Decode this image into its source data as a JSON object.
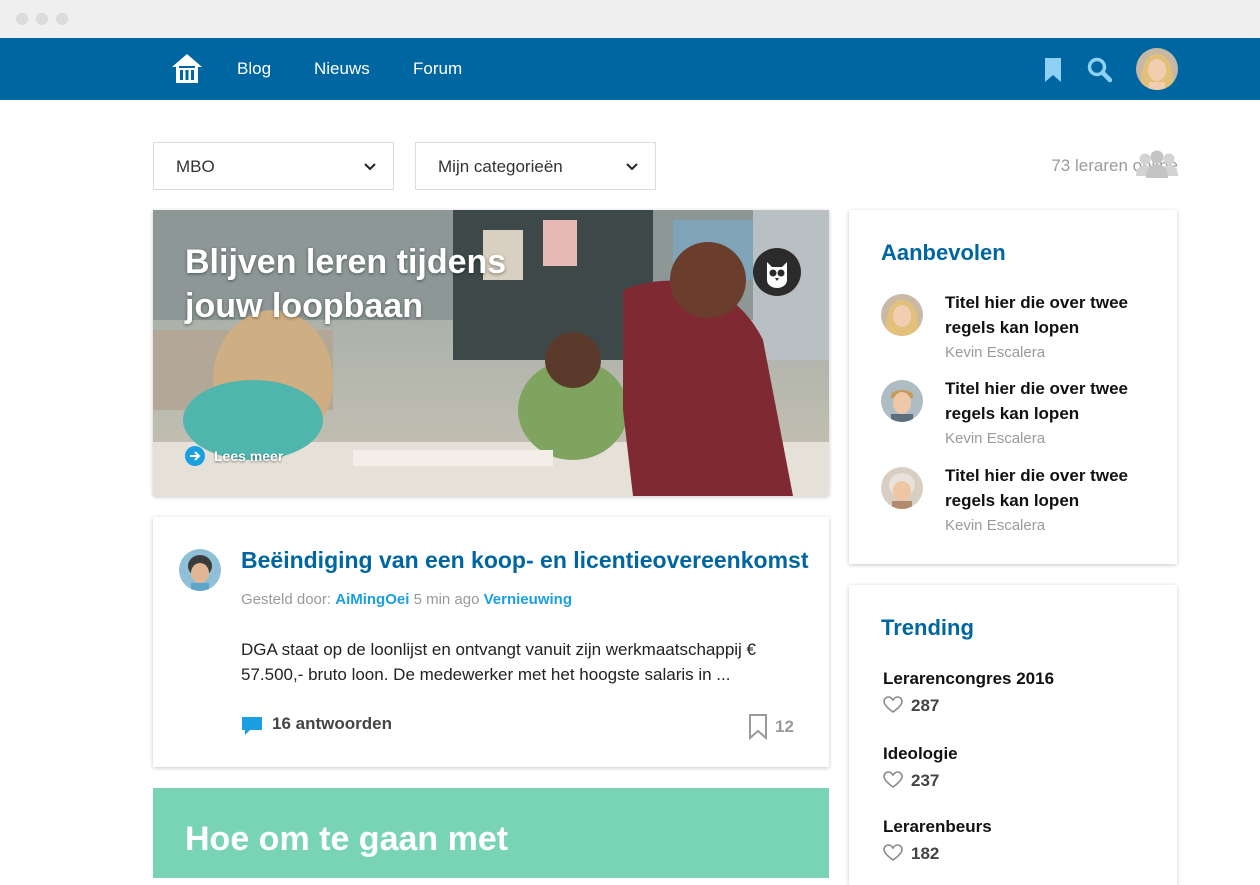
{
  "nav": {
    "links": [
      "Blog",
      "Nieuws",
      "Forum"
    ],
    "icons": [
      "home-icon",
      "bookmark-icon",
      "search-icon",
      "user-avatar"
    ]
  },
  "filters": {
    "level": "MBO",
    "categories": "Mijn categorieën"
  },
  "online": {
    "text": "73 leraren online"
  },
  "hero": {
    "title": "Blijven leren tijdens jouw loopbaan",
    "cta": "Lees meer"
  },
  "post": {
    "title": "Beëindiging van een koop- en licentieovereenkomst",
    "meta_prefix": "Gesteld door:",
    "author": "AiMingOei",
    "time": "5 min ago",
    "category": "Vernieuwing",
    "body": "DGA staat op de loonlijst en ontvangt vanuit zijn werkmaatschappij € 57.500,- bruto loon. De medewerker met het hoogste salaris in ...",
    "replies": "16 antwoorden",
    "bookmarks": "12"
  },
  "teaser": {
    "title": "Hoe om te gaan met"
  },
  "recommended": {
    "heading": "Aanbevolen",
    "items": [
      {
        "title": "Titel hier die over twee regels kan lopen",
        "author": "Kevin Escalera"
      },
      {
        "title": "Titel hier die over twee regels kan lopen",
        "author": "Kevin Escalera"
      },
      {
        "title": "Titel hier die over twee regels kan lopen",
        "author": "Kevin Escalera"
      }
    ]
  },
  "trending": {
    "heading": "Trending",
    "items": [
      {
        "name": "Lerarencongres 2016",
        "count": "287"
      },
      {
        "name": "Ideologie",
        "count": "237"
      },
      {
        "name": "Lerarenbeurs",
        "count": "182"
      }
    ]
  },
  "colors": {
    "primary": "#0066a1",
    "accent": "#1a9fe0",
    "teaser": "#78d4b5"
  }
}
